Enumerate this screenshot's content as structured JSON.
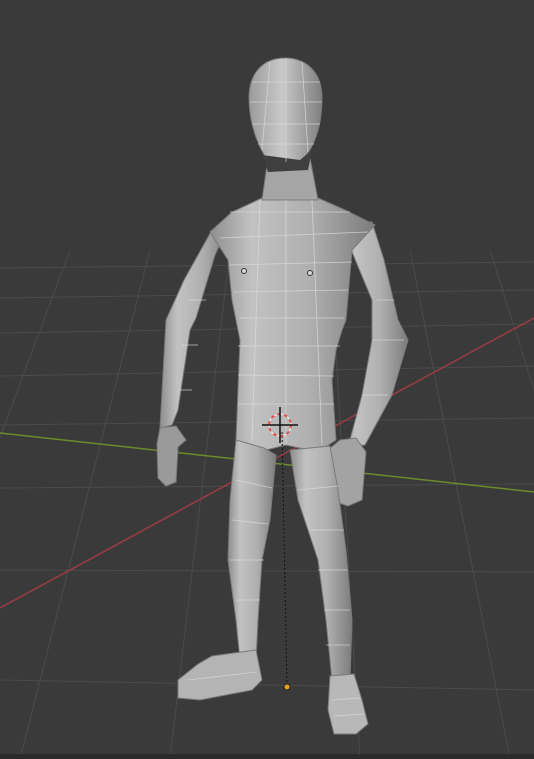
{
  "app": "3D viewport",
  "viewport": {
    "background_color": "#3a3a3a",
    "grid_color": "#4a4a4a",
    "x_axis_color": "#9b3c45",
    "y_axis_color": "#6c8a2b",
    "mesh_color": "#a7a7a7",
    "mesh_edge_color": "#d9d9d9",
    "origin_color": "#f4a01a"
  },
  "scene": {
    "object": "humanoid-mesh",
    "shading": "solid",
    "overlays": [
      "floor-grid",
      "x-axis-line",
      "y-axis-line",
      "wireframe-edges",
      "object-origin",
      "3d-cursor"
    ]
  },
  "icons": {
    "cursor": "3d-cursor-icon",
    "origin": "object-origin-icon"
  }
}
